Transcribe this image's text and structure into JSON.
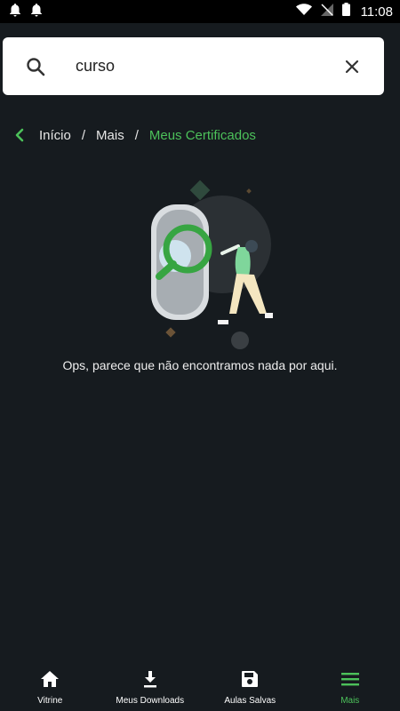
{
  "status_bar": {
    "time": "11:08",
    "icons": [
      "notification-bell-icon",
      "notification-bell-icon",
      "wifi-icon",
      "signal-off-icon",
      "battery-icon"
    ]
  },
  "search": {
    "value": "curso",
    "placeholder": "",
    "search_icon": "search-icon",
    "clear_icon": "close-icon"
  },
  "breadcrumb": {
    "back_icon": "chevron-left-icon",
    "items": [
      "Início",
      "Mais",
      "Meus Certificados"
    ],
    "separator": "/"
  },
  "empty_state": {
    "message": "Ops, parece que não encontramos nada por aqui."
  },
  "bottom_nav": {
    "items": [
      {
        "label": "Vitrine",
        "icon": "home-icon"
      },
      {
        "label": "Meus Downloads",
        "icon": "download-icon"
      },
      {
        "label": "Aulas Salvas",
        "icon": "save-icon"
      },
      {
        "label": "Mais",
        "icon": "menu-icon"
      }
    ],
    "active_index": 3
  },
  "colors": {
    "background": "#161b1f",
    "accent": "#4cc15a",
    "status_bar": "#000000",
    "search_bg": "#ffffff"
  }
}
